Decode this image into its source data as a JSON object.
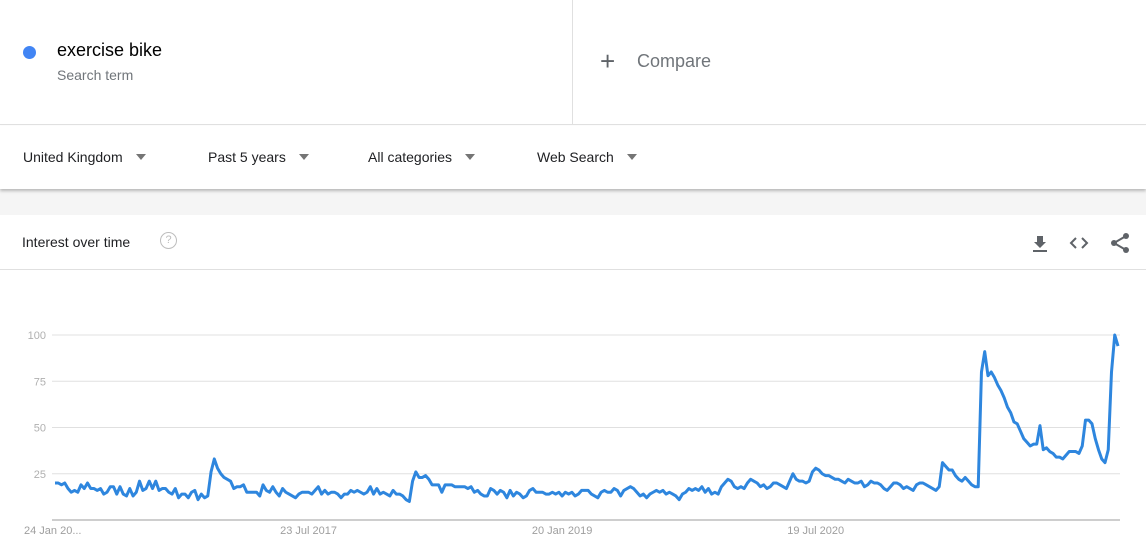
{
  "search_term": {
    "name": "exercise bike",
    "subtitle": "Search term",
    "color": "#4285f4"
  },
  "compare": {
    "icon": "plus-icon",
    "label": "Compare"
  },
  "filters": [
    {
      "label": "United Kingdom",
      "icon": "caret-down-icon"
    },
    {
      "label": "Past 5 years",
      "icon": "caret-down-icon"
    },
    {
      "label": "All categories",
      "icon": "caret-down-icon"
    },
    {
      "label": "Web Search",
      "icon": "caret-down-icon"
    }
  ],
  "card": {
    "title": "Interest over time",
    "help_icon": "help-circle-icon",
    "help_glyph": "?",
    "actions": [
      {
        "name": "download-icon"
      },
      {
        "name": "embed-code-icon"
      },
      {
        "name": "share-icon"
      }
    ]
  },
  "chart_data": {
    "type": "line",
    "title": "Interest over time",
    "xlabel": "",
    "ylabel": "",
    "ylim": [
      0,
      100
    ],
    "yticks": [
      25,
      50,
      75,
      100
    ],
    "xtick_labels": [
      "24 Jan 20...",
      "23 Jul 2017",
      "20 Jan 2019",
      "19 Jul 2020"
    ],
    "xtick_indices": [
      0,
      78,
      156,
      234
    ],
    "grid": true,
    "legend": "none",
    "line_color": "#2e86de",
    "series": [
      {
        "name": "exercise bike",
        "values": [
          20,
          20,
          19,
          20,
          17,
          15,
          16,
          15,
          19,
          17,
          20,
          17,
          17,
          16,
          17,
          14,
          15,
          18,
          18,
          14,
          18,
          14,
          13,
          17,
          13,
          15,
          21,
          16,
          17,
          21,
          17,
          21,
          16,
          17,
          17,
          15,
          14,
          17,
          12,
          14,
          14,
          12,
          15,
          16,
          11,
          14,
          12,
          13,
          26,
          33,
          28,
          25,
          23,
          22,
          21,
          17,
          18,
          18,
          19,
          15,
          15,
          15,
          15,
          13,
          19,
          16,
          15,
          18,
          15,
          13,
          17,
          15,
          14,
          13,
          12,
          14,
          15,
          15,
          15,
          14,
          16,
          18,
          14,
          16,
          14,
          15,
          15,
          14,
          12,
          14,
          14,
          16,
          15,
          16,
          15,
          14,
          15,
          18,
          14,
          17,
          14,
          15,
          14,
          13,
          16,
          14,
          14,
          13,
          11,
          10,
          21,
          26,
          23,
          23,
          24,
          22,
          19,
          19,
          19,
          15,
          19,
          19,
          19,
          18,
          18,
          18,
          18,
          17,
          18,
          15,
          16,
          14,
          13,
          13,
          17,
          16,
          14,
          16,
          15,
          12,
          16,
          13,
          15,
          14,
          12,
          13,
          16,
          17,
          15,
          15,
          15,
          14,
          14,
          15,
          14,
          15,
          13,
          15,
          14,
          15,
          13,
          14,
          16,
          16,
          16,
          14,
          13,
          12,
          15,
          16,
          15,
          15,
          17,
          16,
          13,
          16,
          17,
          18,
          17,
          15,
          13,
          14,
          12,
          14,
          15,
          16,
          15,
          16,
          14,
          15,
          14,
          13,
          11,
          14,
          15,
          17,
          16,
          17,
          16,
          18,
          15,
          17,
          14,
          15,
          14,
          18,
          20,
          22,
          21,
          18,
          17,
          18,
          17,
          20,
          22,
          21,
          20,
          18,
          19,
          17,
          18,
          20,
          20,
          19,
          18,
          17,
          21,
          25,
          22,
          21,
          21,
          20,
          21,
          26,
          28,
          27,
          25,
          24,
          24,
          23,
          22,
          22,
          21,
          20,
          22,
          21,
          20,
          20,
          21,
          18,
          19,
          21,
          20,
          20,
          19,
          17,
          16,
          18,
          20,
          20,
          19,
          17,
          18,
          17,
          16,
          19,
          20,
          20,
          19,
          18,
          17,
          16,
          18,
          31,
          29,
          27,
          27,
          24,
          22,
          21,
          23,
          21,
          19,
          18,
          18,
          80,
          91,
          78,
          80,
          77,
          73,
          70,
          66,
          61,
          58,
          53,
          52,
          48,
          44,
          42,
          40,
          41,
          41,
          51,
          38,
          39,
          37,
          36,
          34,
          34,
          33,
          35,
          37,
          37,
          37,
          36,
          40,
          54,
          54,
          52,
          44,
          38,
          33,
          31,
          38,
          80,
          100,
          94
        ]
      }
    ]
  }
}
